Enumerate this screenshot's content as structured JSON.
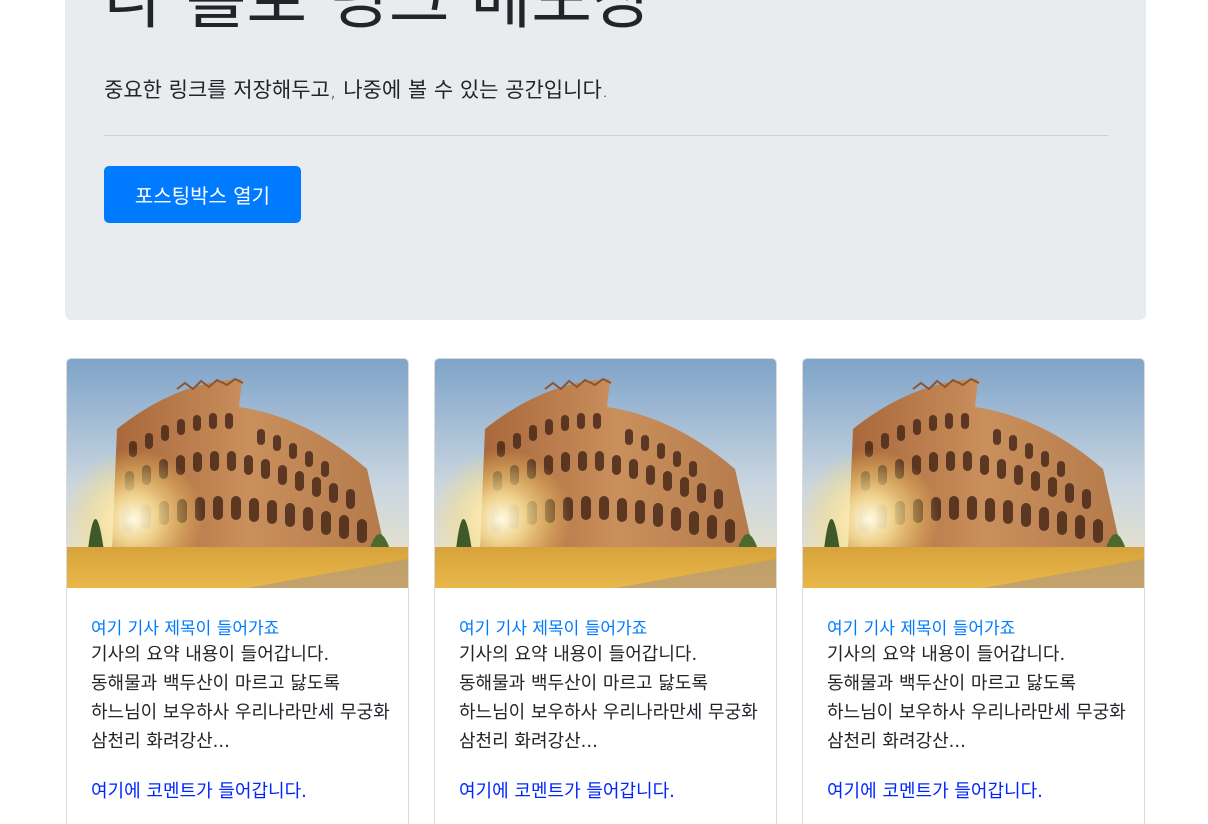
{
  "jumbotron": {
    "title": "나 홀로 링크 메모장",
    "lead": "중요한 링크를 저장해두고, 나중에 볼 수 있는 공간입니다.",
    "button_label": "포스팅박스 열기"
  },
  "cards": [
    {
      "image": "colosseum-photo",
      "title": "여기 기사 제목이 들어가죠",
      "text": "기사의 요약 내용이 들어갑니다. 동해물과 백두산이 마르고 닳도록 하느님이 보우하사 우리나라만세 무궁화 삼천리 화려강산...",
      "comment": "여기에 코멘트가 들어갑니다."
    },
    {
      "image": "colosseum-photo",
      "title": "여기 기사 제목이 들어가죠",
      "text": "기사의 요약 내용이 들어갑니다. 동해물과 백두산이 마르고 닳도록 하느님이 보우하사 우리나라만세 무궁화 삼천리 화려강산...",
      "comment": "여기에 코멘트가 들어갑니다."
    },
    {
      "image": "colosseum-photo",
      "title": "여기 기사 제목이 들어가죠",
      "text": "기사의 요약 내용이 들어갑니다. 동해물과 백두산이 마르고 닳도록 하느님이 보우하사 우리나라만세 무궁화 삼천리 화려강산...",
      "comment": "여기에 코멘트가 들어갑니다."
    }
  ],
  "colors": {
    "primary": "#007bff",
    "comment": "#0026ff",
    "jumbotron_bg": "#e9ecef"
  }
}
